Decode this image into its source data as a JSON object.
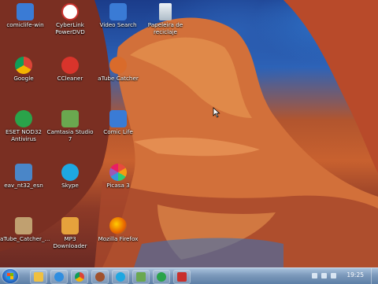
{
  "desktop": {
    "icons": [
      {
        "label": "comiclife-win",
        "icon": "comiclife-icon",
        "color": "#3a7bd5"
      },
      {
        "label": "CyberLink PowerDVD",
        "icon": "powerdvd-icon",
        "color": "#c9302c"
      },
      {
        "label": "Video Search",
        "icon": "video-search-icon",
        "color": "#3a7bd5"
      },
      {
        "label": "Papeleira de reciclaje",
        "icon": "recycle-bin-icon",
        "color": "#cfd8e0"
      },
      {
        "label": "Google",
        "icon": "chrome-icon",
        "color": "#e44d26"
      },
      {
        "label": "CCleaner",
        "icon": "ccleaner-icon",
        "color": "#d9342b"
      },
      {
        "label": "aTube Catcher",
        "icon": "atube-catcher-icon",
        "color": "#d96b2b"
      },
      {
        "label": "ESET NOD32 Antivirus",
        "icon": "eset-icon",
        "color": "#2aa34a"
      },
      {
        "label": "Camtasia Studio 7",
        "icon": "camtasia-icon",
        "color": "#6aa84f"
      },
      {
        "label": "Comic Life",
        "icon": "comic-life-icon",
        "color": "#3a7bd5"
      },
      {
        "label": "eav_nt32_esn",
        "icon": "installer-icon",
        "color": "#4a86c8"
      },
      {
        "label": "Skype",
        "icon": "skype-icon",
        "color": "#1ea7e1"
      },
      {
        "label": "Picasa 3",
        "icon": "picasa-icon",
        "color": "#9b59b6"
      },
      {
        "label": "aTube_Catcher_...",
        "icon": "atube-installer-icon",
        "color": "#c0a070"
      },
      {
        "label": "MP3 Downloader",
        "icon": "mp3-downloader-icon",
        "color": "#e6a23c"
      },
      {
        "label": "Mozilla Firefox",
        "icon": "firefox-icon",
        "color": "#e66000"
      }
    ]
  },
  "taskbar": {
    "clock": "19:25",
    "pinned": [
      {
        "name": "explorer",
        "color": "#f0c040"
      },
      {
        "name": "media-player",
        "color": "#2f8ee0"
      },
      {
        "name": "chrome",
        "color": "#e44d26"
      },
      {
        "name": "atube",
        "color": "#a0522d"
      },
      {
        "name": "skype",
        "color": "#1ea7e1"
      },
      {
        "name": "camtasia",
        "color": "#6aa84f"
      },
      {
        "name": "eset",
        "color": "#2aa34a"
      },
      {
        "name": "recorder",
        "color": "#c9302c"
      }
    ]
  }
}
